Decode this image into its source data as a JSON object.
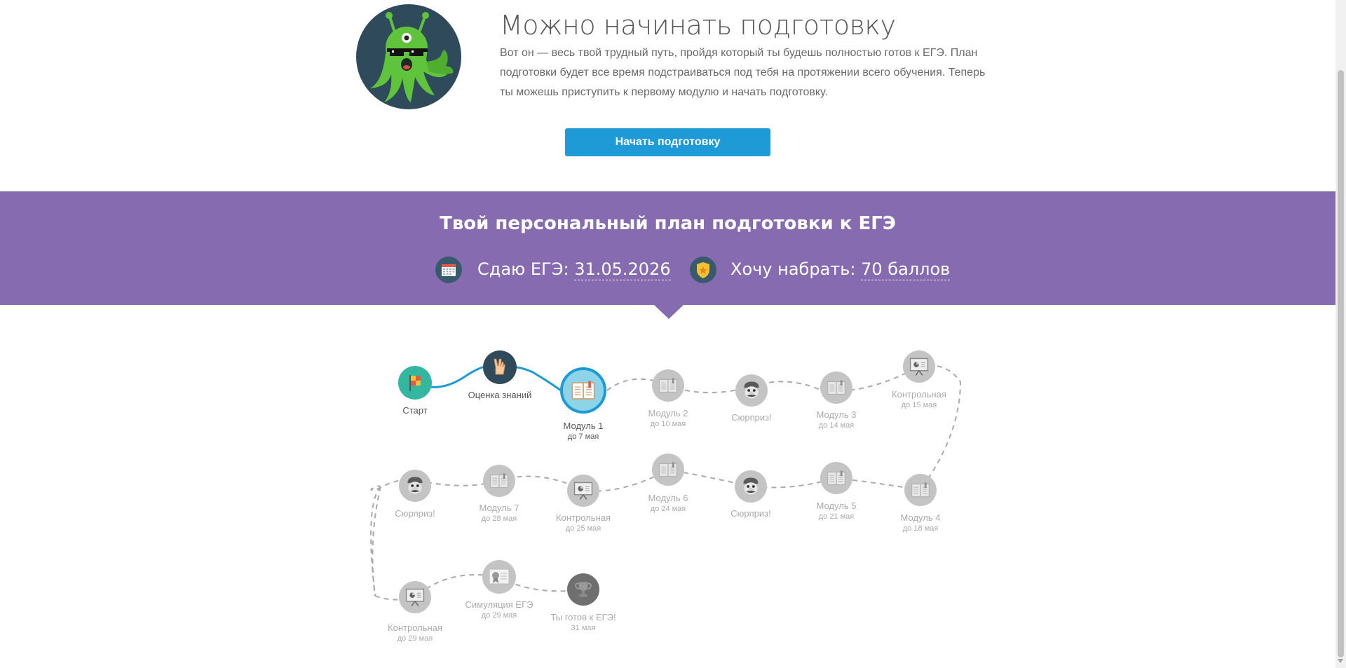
{
  "intro": {
    "title": "Можно начинать подготовку",
    "text": "Вот он — весь твой трудный путь, пройдя который ты будешь полностью готов к ЕГЭ. План подготовки будет все время подстраиваться под тебя на протяжении всего обучения. Теперь ты можешь приступить к первому модулю и начать подготовку.",
    "button_label": "Начать подготовку"
  },
  "plan": {
    "title": "Твой персональный план подготовки к ЕГЭ",
    "exam_prefix": "Сдаю ЕГЭ:",
    "exam_date": "31.05.2026",
    "score_prefix": "Хочу набрать:",
    "score_value": "70 баллов"
  },
  "colors": {
    "primary_button": "#1e9bd7",
    "band": "#866bb1",
    "active_ring": "#1e9bd7",
    "completed_path": "#1e9bd7",
    "inactive": "#b9b9b9"
  },
  "roadmap": {
    "nodes": [
      {
        "name": "Старт",
        "date": "",
        "icon": "flag-icon",
        "state": "done"
      },
      {
        "name": "Оценка знаний",
        "date": "",
        "icon": "rock-hand-icon",
        "state": "done"
      },
      {
        "name": "Модуль 1",
        "date": "до 7 мая",
        "icon": "book-icon",
        "state": "active"
      },
      {
        "name": "Модуль 2",
        "date": "до 10 мая",
        "icon": "book-icon",
        "state": "locked"
      },
      {
        "name": "Сюрприз!",
        "date": "",
        "icon": "mario-face-icon",
        "state": "locked"
      },
      {
        "name": "Модуль 3",
        "date": "до 14 мая",
        "icon": "book-icon",
        "state": "locked"
      },
      {
        "name": "Контрольная",
        "date": "до 15 мая",
        "icon": "presentation-board-icon",
        "state": "locked"
      },
      {
        "name": "Модуль 4",
        "date": "до 18 мая",
        "icon": "book-icon",
        "state": "locked"
      },
      {
        "name": "Модуль 5",
        "date": "до 21 мая",
        "icon": "book-icon",
        "state": "locked"
      },
      {
        "name": "Сюрприз!",
        "date": "",
        "icon": "mario-face-icon",
        "state": "locked"
      },
      {
        "name": "Модуль 6",
        "date": "до 24 мая",
        "icon": "book-icon",
        "state": "locked"
      },
      {
        "name": "Контрольная",
        "date": "до 25 мая",
        "icon": "presentation-board-icon",
        "state": "locked"
      },
      {
        "name": "Модуль 7",
        "date": "до 28 мая",
        "icon": "book-icon",
        "state": "locked"
      },
      {
        "name": "Сюрприз!",
        "date": "",
        "icon": "mario-face-icon",
        "state": "locked"
      },
      {
        "name": "Контрольная",
        "date": "до 29 мая",
        "icon": "presentation-board-icon",
        "state": "locked"
      },
      {
        "name": "Симуляция ЕГЭ",
        "date": "до 29 мая",
        "icon": "certificate-icon",
        "state": "locked"
      },
      {
        "name": "Ты готов к ЕГЭ!",
        "date": "31 мая",
        "icon": "trophy-icon",
        "state": "locked"
      }
    ]
  }
}
